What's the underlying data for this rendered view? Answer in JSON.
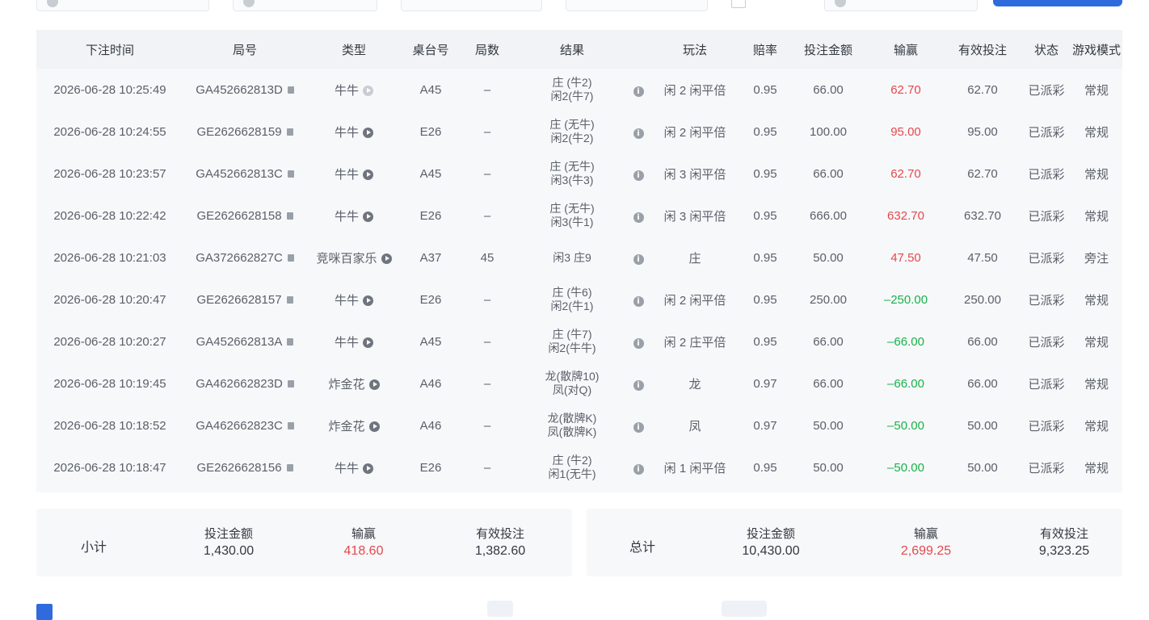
{
  "table": {
    "headers": [
      "下注时间",
      "局号",
      "类型",
      "桌台号",
      "局数",
      "结果",
      "玩法",
      "赔率",
      "投注金额",
      "输赢",
      "有效投注",
      "状态",
      "游戏模式"
    ],
    "rows": [
      {
        "time": "2026-06-28 10:25:49",
        "round_id": "GA452662813D",
        "type": "牛牛",
        "play_disabled": true,
        "table": "A45",
        "count": "–",
        "result_1": "庄 (牛2)",
        "result_2": "闲2(牛7)",
        "bet": "闲 2 闲平倍",
        "odds": "0.95",
        "amount": "66.00",
        "winloss": "62.70",
        "win": true,
        "valid": "62.70",
        "status": "已派彩",
        "mode": "常规"
      },
      {
        "time": "2026-06-28 10:24:55",
        "round_id": "GE2626628159",
        "type": "牛牛",
        "play_disabled": false,
        "table": "E26",
        "count": "–",
        "result_1": "庄 (无牛)",
        "result_2": "闲2(牛2)",
        "bet": "闲 2 闲平倍",
        "odds": "0.95",
        "amount": "100.00",
        "winloss": "95.00",
        "win": true,
        "valid": "95.00",
        "status": "已派彩",
        "mode": "常规"
      },
      {
        "time": "2026-06-28 10:23:57",
        "round_id": "GA452662813C",
        "type": "牛牛",
        "play_disabled": false,
        "table": "A45",
        "count": "–",
        "result_1": "庄 (无牛)",
        "result_2": "闲3(牛3)",
        "bet": "闲 3 闲平倍",
        "odds": "0.95",
        "amount": "66.00",
        "winloss": "62.70",
        "win": true,
        "valid": "62.70",
        "status": "已派彩",
        "mode": "常规"
      },
      {
        "time": "2026-06-28 10:22:42",
        "round_id": "GE2626628158",
        "type": "牛牛",
        "play_disabled": false,
        "table": "E26",
        "count": "–",
        "result_1": "庄 (无牛)",
        "result_2": "闲3(牛1)",
        "bet": "闲 3 闲平倍",
        "odds": "0.95",
        "amount": "666.00",
        "winloss": "632.70",
        "win": true,
        "valid": "632.70",
        "status": "已派彩",
        "mode": "常规"
      },
      {
        "time": "2026-06-28 10:21:03",
        "round_id": "GA372662827C",
        "type": "竞咪百家乐",
        "play_disabled": false,
        "table": "A37",
        "count": "45",
        "result_1": "闲3 庄9",
        "result_2": "",
        "bet": "庄",
        "odds": "0.95",
        "amount": "50.00",
        "winloss": "47.50",
        "win": true,
        "valid": "47.50",
        "status": "已派彩",
        "mode": "旁注"
      },
      {
        "time": "2026-06-28 10:20:47",
        "round_id": "GE2626628157",
        "type": "牛牛",
        "play_disabled": false,
        "table": "E26",
        "count": "–",
        "result_1": "庄 (牛6)",
        "result_2": "闲2(牛1)",
        "bet": "闲 2 闲平倍",
        "odds": "0.95",
        "amount": "250.00",
        "winloss": "–250.00",
        "win": false,
        "valid": "250.00",
        "status": "已派彩",
        "mode": "常规"
      },
      {
        "time": "2026-06-28 10:20:27",
        "round_id": "GA452662813A",
        "type": "牛牛",
        "play_disabled": false,
        "table": "A45",
        "count": "–",
        "result_1": "庄 (牛7)",
        "result_2": "闲2(牛牛)",
        "bet": "闲 2 庄平倍",
        "odds": "0.95",
        "amount": "66.00",
        "winloss": "–66.00",
        "win": false,
        "valid": "66.00",
        "status": "已派彩",
        "mode": "常规"
      },
      {
        "time": "2026-06-28 10:19:45",
        "round_id": "GA462662823D",
        "type": "炸金花",
        "play_disabled": false,
        "table": "A46",
        "count": "–",
        "result_1": "龙(散牌10)",
        "result_2": "凤(对Q)",
        "bet": "龙",
        "odds": "0.97",
        "amount": "66.00",
        "winloss": "–66.00",
        "win": false,
        "valid": "66.00",
        "status": "已派彩",
        "mode": "常规"
      },
      {
        "time": "2026-06-28 10:18:52",
        "round_id": "GA462662823C",
        "type": "炸金花",
        "play_disabled": false,
        "table": "A46",
        "count": "–",
        "result_1": "龙(散牌K)",
        "result_2": "凤(散牌K)",
        "bet": "凤",
        "odds": "0.97",
        "amount": "50.00",
        "winloss": "–50.00",
        "win": false,
        "valid": "50.00",
        "status": "已派彩",
        "mode": "常规"
      },
      {
        "time": "2026-06-28 10:18:47",
        "round_id": "GE2626628156",
        "type": "牛牛",
        "play_disabled": false,
        "table": "E26",
        "count": "–",
        "result_1": "庄 (牛2)",
        "result_2": "闲1(无牛)",
        "bet": "闲 1 闲平倍",
        "odds": "0.95",
        "amount": "50.00",
        "winloss": "–50.00",
        "win": false,
        "valid": "50.00",
        "status": "已派彩",
        "mode": "常规"
      }
    ]
  },
  "subtotal": {
    "label": "小计",
    "amount_label": "投注金额",
    "amount": "1,430.00",
    "winloss_label": "输赢",
    "winloss": "418.60",
    "valid_label": "有效投注",
    "valid": "1,382.60"
  },
  "total": {
    "label": "总计",
    "amount_label": "投注金额",
    "amount": "10,430.00",
    "winloss_label": "输赢",
    "winloss": "2,699.25",
    "valid_label": "有效投注",
    "valid": "9,323.25"
  },
  "colors": {
    "win": "#e5484d",
    "lose": "#17b34a",
    "primary": "#2f6bdc"
  }
}
